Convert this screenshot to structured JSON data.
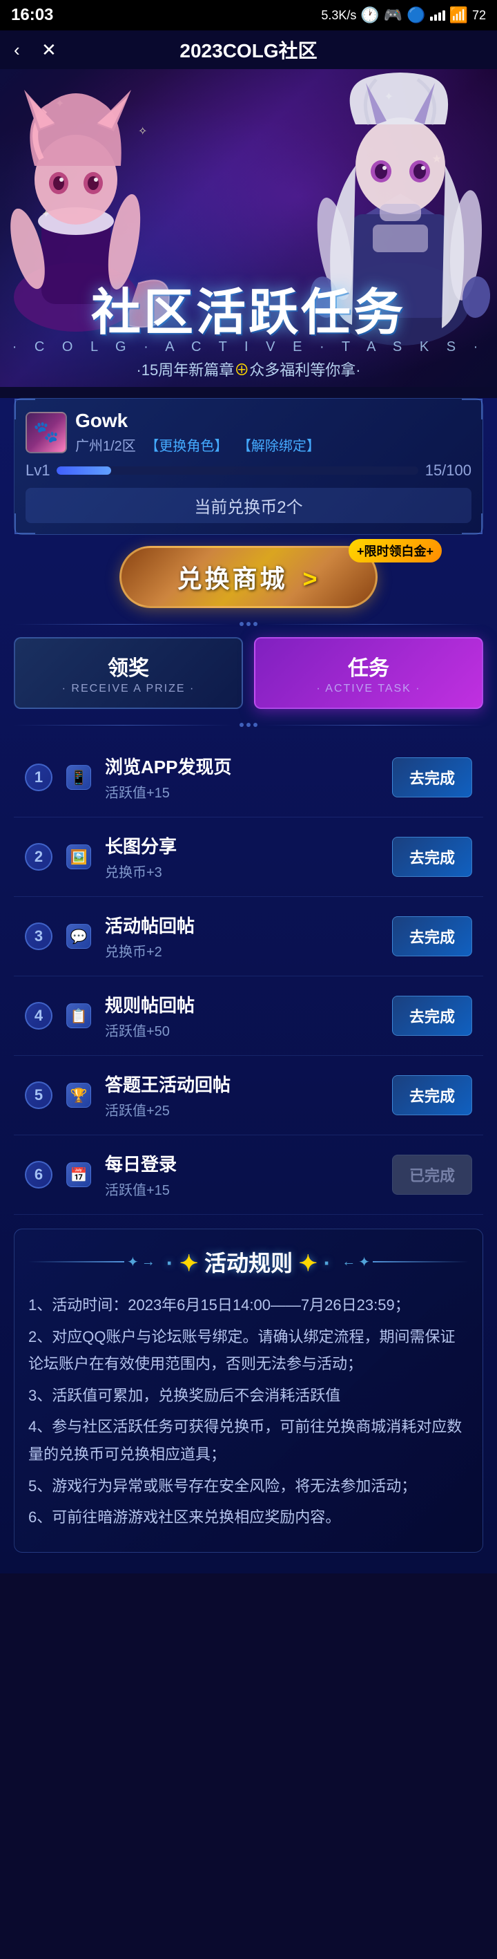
{
  "statusBar": {
    "time": "16:03",
    "network": "5.3K/s",
    "batteryLevel": "72"
  },
  "navBar": {
    "title": "2023COLG社区",
    "backLabel": "‹",
    "closeLabel": "✕"
  },
  "hero": {
    "titleCN": "社区活跃任务",
    "titleEN": "· C O L G · A C T I V E · T A S K S ·",
    "subtitle": "·15周年新篇章⊕众多福利等你拿·"
  },
  "userCard": {
    "name": "Gowk",
    "location": "广州1/2区",
    "changeLinkLabel": "【更换角色】",
    "unbindLinkLabel": "【解除绑定】",
    "lvLabel": "Lv1",
    "lvProgress": 15,
    "lvMax": 100,
    "lvDisplay": "15/100",
    "coinLabel": "当前兑换币2个"
  },
  "shopBanner": {
    "badgeLabel": "+限时领白金+",
    "btnLabel": "兑换商城",
    "btnArrow": " >"
  },
  "tabs": [
    {
      "id": "receive",
      "labelCN": "领奖",
      "labelEN": "· RECEIVE A PRIZE ·",
      "active": false
    },
    {
      "id": "task",
      "labelCN": "任务",
      "labelEN": "· ACTIVE TASK ·",
      "active": true
    }
  ],
  "tasks": [
    {
      "num": "1",
      "title": "浏览APP发现页",
      "reward": "活跃值+15",
      "btnLabel": "去完成",
      "done": false
    },
    {
      "num": "2",
      "title": "长图分享",
      "reward": "兑换币+3",
      "btnLabel": "去完成",
      "done": false
    },
    {
      "num": "3",
      "title": "活动帖回帖",
      "reward": "兑换币+2",
      "btnLabel": "去完成",
      "done": false
    },
    {
      "num": "4",
      "title": "规则帖回帖",
      "reward": "活跃值+50",
      "btnLabel": "去完成",
      "done": false
    },
    {
      "num": "5",
      "title": "答题王活动回帖",
      "reward": "活跃值+25",
      "btnLabel": "去完成",
      "done": false
    },
    {
      "num": "6",
      "title": "每日登录",
      "reward": "活跃值+15",
      "btnLabel": "已完成",
      "done": true
    }
  ],
  "rules": {
    "title": "活动规则",
    "items": [
      "1、活动时间：2023年6月15日14:00——7月26日23:59；",
      "2、对应QQ账户与论坛账号绑定。请确认绑定流程，期间需保证论坛账户在有效使用范围内，否则无法参与活动；",
      "3、活跃值可累加，兑换奖励后不会消耗活跃值",
      "4、参与社区活跃任务可获得兑换币，可前往兑换商城消耗对应数量的兑换币可兑换相应道具；",
      "5、游戏行为异常或账号存在安全风险，将无法参加活动；",
      "6、可前往暗游游戏社区来兑换相应奖励内容。"
    ]
  }
}
